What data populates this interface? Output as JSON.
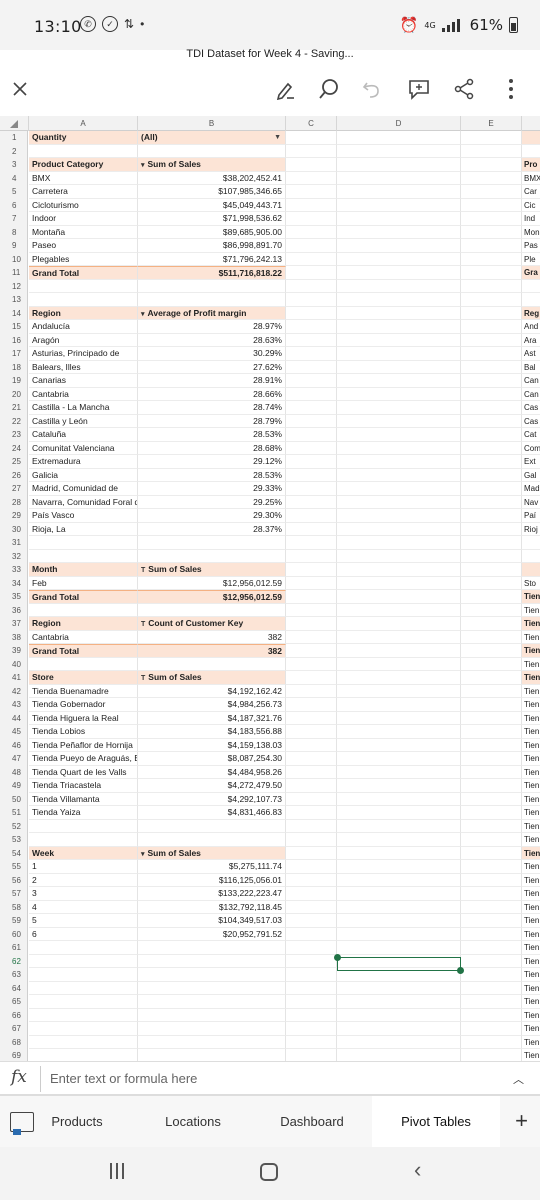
{
  "status": {
    "time": "13:10",
    "network": "4G",
    "battery": "61%"
  },
  "doc": {
    "title": "TDI Dataset for Week 4 - Saving..."
  },
  "columns": [
    "A",
    "B",
    "C",
    "D",
    "E"
  ],
  "rows": [
    {
      "n": "1",
      "a": "Quantity",
      "b": "(All)",
      "style": "hdr",
      "dd": true,
      "f": ""
    },
    {
      "n": "2",
      "a": "",
      "b": "",
      "f": ""
    },
    {
      "n": "3",
      "a": "Product Category",
      "b": "Sum of Sales",
      "style": "hdr",
      "filter": "▾",
      "f": "Pro"
    },
    {
      "n": "4",
      "a": "BMX",
      "b": "$38,202,452.41",
      "num": true,
      "f": "BMX"
    },
    {
      "n": "5",
      "a": "Carretera",
      "b": "$107,985,346.65",
      "num": true,
      "f": "Car"
    },
    {
      "n": "6",
      "a": "Cicloturismo",
      "b": "$45,049,443.71",
      "num": true,
      "f": "Cic"
    },
    {
      "n": "7",
      "a": "Indoor",
      "b": "$71,998,536.62",
      "num": true,
      "f": "Ind"
    },
    {
      "n": "8",
      "a": "Montaña",
      "b": "$89,685,905.00",
      "num": true,
      "f": "Mon"
    },
    {
      "n": "9",
      "a": "Paseo",
      "b": "$86,998,891.70",
      "num": true,
      "f": "Pas"
    },
    {
      "n": "10",
      "a": "Plegables",
      "b": "$71,796,242.13",
      "num": true,
      "f": "Ple"
    },
    {
      "n": "11",
      "a": "Grand Total",
      "b": "$511,716,818.22",
      "num": true,
      "style": "tot",
      "f": "Gra"
    },
    {
      "n": "12",
      "a": "",
      "b": "",
      "f": ""
    },
    {
      "n": "13",
      "a": "",
      "b": "",
      "f": ""
    },
    {
      "n": "14",
      "a": "Region",
      "b": "Average of Profit margin",
      "style": "hdr",
      "filter": "▾",
      "f": "Reg"
    },
    {
      "n": "15",
      "a": "Andalucía",
      "b": "28.97%",
      "num": true,
      "f": "And"
    },
    {
      "n": "16",
      "a": "Aragón",
      "b": "28.63%",
      "num": true,
      "f": "Ara"
    },
    {
      "n": "17",
      "a": "Asturias, Principado de",
      "b": "30.29%",
      "num": true,
      "f": "Ast"
    },
    {
      "n": "18",
      "a": "Balears, Illes",
      "b": "27.62%",
      "num": true,
      "f": "Bal"
    },
    {
      "n": "19",
      "a": "Canarias",
      "b": "28.91%",
      "num": true,
      "f": "Can"
    },
    {
      "n": "20",
      "a": "Cantabria",
      "b": "28.66%",
      "num": true,
      "f": "Can"
    },
    {
      "n": "21",
      "a": "Castilla - La Mancha",
      "b": "28.74%",
      "num": true,
      "f": "Cas"
    },
    {
      "n": "22",
      "a": "Castilla y León",
      "b": "28.79%",
      "num": true,
      "f": "Cas"
    },
    {
      "n": "23",
      "a": "Cataluña",
      "b": "28.53%",
      "num": true,
      "f": "Cat"
    },
    {
      "n": "24",
      "a": "Comunitat Valenciana",
      "b": "28.68%",
      "num": true,
      "f": "Com"
    },
    {
      "n": "25",
      "a": "Extremadura",
      "b": "29.12%",
      "num": true,
      "f": "Ext"
    },
    {
      "n": "26",
      "a": "Galicia",
      "b": "28.53%",
      "num": true,
      "f": "Gal"
    },
    {
      "n": "27",
      "a": "Madrid, Comunidad de",
      "b": "29.33%",
      "num": true,
      "f": "Mad"
    },
    {
      "n": "28",
      "a": "Navarra, Comunidad Foral de",
      "b": "29.25%",
      "num": true,
      "f": "Nav"
    },
    {
      "n": "29",
      "a": "País Vasco",
      "b": "29.30%",
      "num": true,
      "f": "Paí"
    },
    {
      "n": "30",
      "a": "Rioja, La",
      "b": "28.37%",
      "num": true,
      "f": "Rioj"
    },
    {
      "n": "31",
      "a": "",
      "b": "",
      "f": ""
    },
    {
      "n": "32",
      "a": "",
      "b": "",
      "f": ""
    },
    {
      "n": "33",
      "a": "Month",
      "b": "Sum of Sales",
      "style": "hdr",
      "filter": "T",
      "f": ""
    },
    {
      "n": "34",
      "a": "Feb",
      "b": "$12,956,012.59",
      "num": true,
      "f": "Sto"
    },
    {
      "n": "35",
      "a": "Grand Total",
      "b": "$12,956,012.59",
      "num": true,
      "style": "tot",
      "f": "Tien"
    },
    {
      "n": "36",
      "a": "",
      "b": "",
      "f": "Tien"
    },
    {
      "n": "37",
      "a": "Region",
      "b": "Count of Customer Key",
      "style": "hdr",
      "filter": "T",
      "f": "Tien"
    },
    {
      "n": "38",
      "a": "Cantabria",
      "b": "382",
      "num": true,
      "f": "Tien"
    },
    {
      "n": "39",
      "a": "Grand Total",
      "b": "382",
      "num": true,
      "style": "tot",
      "f": "Tien"
    },
    {
      "n": "40",
      "a": "",
      "b": "",
      "f": "Tien"
    },
    {
      "n": "41",
      "a": "Store",
      "b": "Sum of Sales",
      "style": "hdr",
      "filter": "T",
      "f": "Tien"
    },
    {
      "n": "42",
      "a": "Tienda Buenamadre",
      "b": "$4,192,162.42",
      "num": true,
      "f": "Tien"
    },
    {
      "n": "43",
      "a": "Tienda Gobernador",
      "b": "$4,984,256.73",
      "num": true,
      "f": "Tien"
    },
    {
      "n": "44",
      "a": "Tienda Higuera la Real",
      "b": "$4,187,321.76",
      "num": true,
      "f": "Tien"
    },
    {
      "n": "45",
      "a": "Tienda Lobios",
      "b": "$4,183,556.88",
      "num": true,
      "f": "Tien"
    },
    {
      "n": "46",
      "a": "Tienda Peñaflor de Hornija",
      "b": "$4,159,138.03",
      "num": true,
      "f": "Tien"
    },
    {
      "n": "47",
      "a": "Tienda Pueyo de Araguás, El",
      "b": "$8,087,254.30",
      "num": true,
      "f": "Tien"
    },
    {
      "n": "48",
      "a": "Tienda Quart de les Valls",
      "b": "$4,484,958.26",
      "num": true,
      "f": "Tien"
    },
    {
      "n": "49",
      "a": "Tienda Triacastela",
      "b": "$4,272,479.50",
      "num": true,
      "f": "Tien"
    },
    {
      "n": "50",
      "a": "Tienda Villamanta",
      "b": "$4,292,107.73",
      "num": true,
      "f": "Tien"
    },
    {
      "n": "51",
      "a": "Tienda Yaiza",
      "b": "$4,831,466.83",
      "num": true,
      "f": "Tien"
    },
    {
      "n": "52",
      "a": "",
      "b": "",
      "f": "Tien"
    },
    {
      "n": "53",
      "a": "",
      "b": "",
      "f": "Tien"
    },
    {
      "n": "54",
      "a": "Week",
      "b": "Sum of Sales",
      "style": "hdr",
      "filter": "▾",
      "f": "Tien"
    },
    {
      "n": "55",
      "a": "1",
      "b": "$5,275,111.74",
      "num": true,
      "f": "Tien"
    },
    {
      "n": "56",
      "a": "2",
      "b": "$116,125,056.01",
      "num": true,
      "f": "Tien"
    },
    {
      "n": "57",
      "a": "3",
      "b": "$133,222,223.47",
      "num": true,
      "f": "Tien"
    },
    {
      "n": "58",
      "a": "4",
      "b": "$132,792,118.45",
      "num": true,
      "f": "Tien"
    },
    {
      "n": "59",
      "a": "5",
      "b": "$104,349,517.03",
      "num": true,
      "f": "Tien"
    },
    {
      "n": "60",
      "a": "6",
      "b": "$20,952,791.52",
      "num": true,
      "f": "Tien"
    },
    {
      "n": "61",
      "a": "",
      "b": "",
      "f": "Tien"
    },
    {
      "n": "62",
      "a": "",
      "b": "",
      "f": "Tien",
      "selected": true
    },
    {
      "n": "63",
      "a": "",
      "b": "",
      "f": "Tien"
    },
    {
      "n": "64",
      "a": "",
      "b": "",
      "f": "Tien"
    },
    {
      "n": "65",
      "a": "",
      "b": "",
      "f": "Tien"
    },
    {
      "n": "66",
      "a": "",
      "b": "",
      "f": "Tien"
    },
    {
      "n": "67",
      "a": "",
      "b": "",
      "f": "Tien"
    },
    {
      "n": "68",
      "a": "",
      "b": "",
      "f": "Tien"
    },
    {
      "n": "69",
      "a": "",
      "b": "",
      "f": "Tien"
    }
  ],
  "formula": {
    "placeholder": "Enter text or formula here"
  },
  "tabs": [
    {
      "label": "Products",
      "active": false
    },
    {
      "label": "Locations",
      "active": false
    },
    {
      "label": "Dashboard",
      "active": false
    },
    {
      "label": "Pivot Tables",
      "active": true
    }
  ]
}
